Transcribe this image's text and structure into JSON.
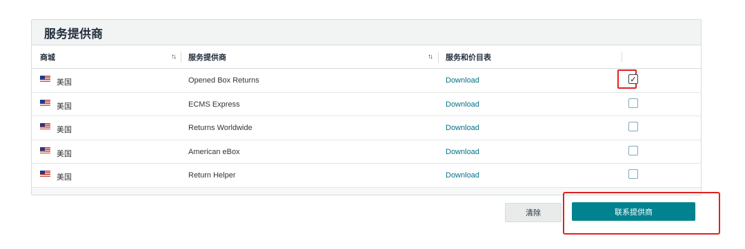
{
  "section": {
    "title": "服务提供商"
  },
  "table": {
    "headers": {
      "marketplace": "商城",
      "provider": "服务提供商",
      "pricing": "服务和价目表"
    },
    "sort_icon": "↑↓",
    "rows": [
      {
        "country": "美国",
        "provider": "Opened Box Returns",
        "link": "Download",
        "checked": true
      },
      {
        "country": "美国",
        "provider": "ECMS Express",
        "link": "Download",
        "checked": false
      },
      {
        "country": "美国",
        "provider": "Returns Worldwide",
        "link": "Download",
        "checked": false
      },
      {
        "country": "美国",
        "provider": "American eBox",
        "link": "Download",
        "checked": false
      },
      {
        "country": "美国",
        "provider": "Return Helper",
        "link": "Download",
        "checked": false
      }
    ],
    "check_mark": "✓"
  },
  "actions": {
    "clear_label": "清除",
    "contact_label": "联系提供商"
  },
  "colors": {
    "primary": "#00838f",
    "link": "#007185",
    "highlight": "#e02020"
  }
}
